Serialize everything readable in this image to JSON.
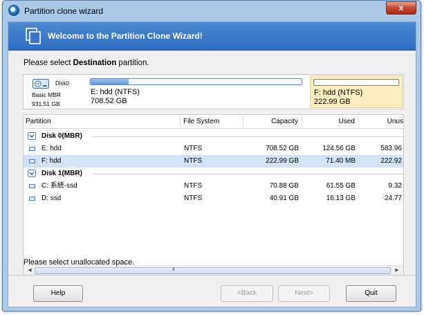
{
  "window": {
    "title": "Partition clone wizard",
    "close_glyph": "x"
  },
  "banner": {
    "title": "Welcome to the Partition Clone Wizard!"
  },
  "instruction": {
    "prefix": "Please select ",
    "emphasis": "Destination",
    "suffix": " partition."
  },
  "disk_map": {
    "disk_name": "Disk0",
    "disk_type": "Basic MBR",
    "disk_size": "931.51 GB",
    "partitions": [
      {
        "label": "E: hdd (NTFS)",
        "size": "708.52 GB",
        "used_fraction": 0.18
      },
      {
        "label": "F: hdd (NTFS)",
        "size": "222.99 GB",
        "used_fraction": 0.0
      }
    ],
    "selected_color": "#fcefbf"
  },
  "table": {
    "columns": [
      "Partition",
      "File System",
      "Capacity",
      "Used",
      "Unus"
    ],
    "groups": [
      {
        "label": "Disk 0(MBR)",
        "rows": [
          {
            "partition": "E: hdd",
            "fs": "NTFS",
            "capacity": "708.52 GB",
            "used": "124.56 GB",
            "unused": "583.96"
          },
          {
            "partition": "F: hdd",
            "fs": "NTFS",
            "capacity": "222.99 GB",
            "used": "71.40 MB",
            "unused": "222.92",
            "selected": true
          }
        ]
      },
      {
        "label": "Disk 1(MBR)",
        "rows": [
          {
            "partition": "C: 系統-ssd",
            "fs": "NTFS",
            "capacity": "70.88 GB",
            "used": "61.55 GB",
            "unused": "9.32"
          },
          {
            "partition": "D: ssd",
            "fs": "NTFS",
            "capacity": "40.91 GB",
            "used": "16.13 GB",
            "unused": "24.77"
          }
        ]
      }
    ],
    "scroll_grip": "III"
  },
  "status": "Please select unallocated space.",
  "buttons": {
    "help": "Help",
    "back": "<Back",
    "next": "Next>",
    "quit": "Quit"
  },
  "colors": {
    "banner": "#3f7cc9",
    "selected_row": "#d3e2f7"
  }
}
